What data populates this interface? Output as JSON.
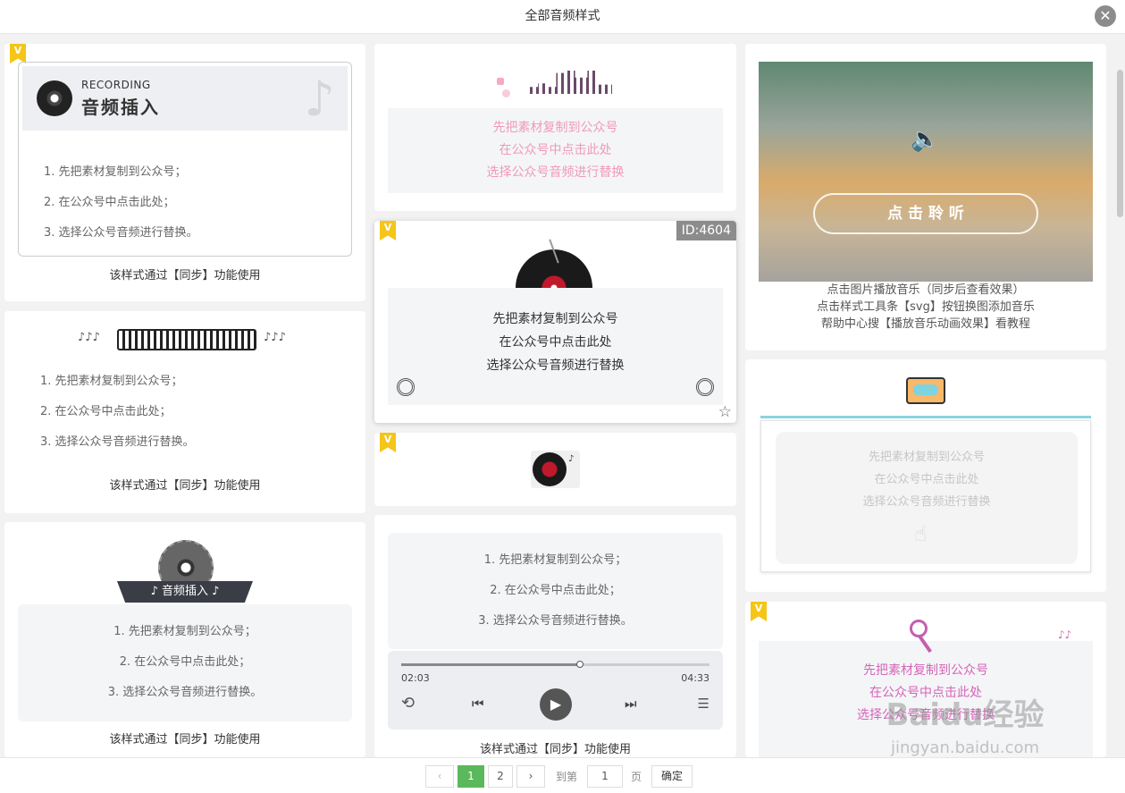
{
  "header": {
    "title": "全部音频样式"
  },
  "card1": {
    "brand_en": "RECORDING",
    "brand_cn": "音频插入",
    "steps": [
      "1. 先把素材复制到公众号；",
      "2. 在公众号中点击此处；",
      "3. 选择公众号音频进行替换。"
    ],
    "caption": "该样式通过【同步】功能使用"
  },
  "card2": {
    "steps": [
      "1. 先把素材复制到公众号；",
      "2. 在公众号中点击此处；",
      "3. 选择公众号音频进行替换。"
    ],
    "caption": "该样式通过【同步】功能使用"
  },
  "card3": {
    "banner": "♪ 音频插入 ♪",
    "steps": [
      "1. 先把素材复制到公众号；",
      "2. 在公众号中点击此处；",
      "3. 选择公众号音频进行替换。"
    ],
    "caption": "该样式通过【同步】功能使用"
  },
  "card4": {
    "lines": [
      "先把素材复制到公众号",
      "在公众号中点击此处",
      "选择公众号音频进行替换"
    ]
  },
  "card5": {
    "id_badge": "ID:4604",
    "lines": [
      "先把素材复制到公众号",
      "在公众号中点击此处",
      "选择公众号音频进行替换"
    ]
  },
  "card7": {
    "steps": [
      "1. 先把素材复制到公众号；",
      "2. 在公众号中点击此处；",
      "3. 选择公众号音频进行替换。"
    ],
    "time_current": "02:03",
    "time_total": "04:33",
    "progress": 0.58,
    "caption": "该样式通过【同步】功能使用"
  },
  "card8": {
    "button": "点 击 聆 听",
    "notes": [
      "点击图片播放音乐（同步后查看效果）",
      "点击样式工具条【svg】按钮换图添加音乐",
      "帮助中心搜【播放音乐动画效果】看教程"
    ]
  },
  "card9": {
    "lines": [
      "先把素材复制到公众号",
      "在公众号中点击此处",
      "选择公众号音频进行替换"
    ]
  },
  "card10": {
    "lines": [
      "先把素材复制到公众号",
      "在公众号中点击此处",
      "选择公众号音频进行替换"
    ]
  },
  "pagination": {
    "prev": "‹",
    "page1": "1",
    "page2": "2",
    "next": "›",
    "goto_label": "到第",
    "goto_value": "1",
    "page_unit": "页",
    "confirm": "确定"
  },
  "watermark": {
    "line1": "Baidu经验",
    "line2": "jingyan.baidu.com"
  },
  "colors": {
    "accent_green": "#5cb85c",
    "pink_text": "#f09ab8",
    "vip_gold": "#f5c518"
  }
}
